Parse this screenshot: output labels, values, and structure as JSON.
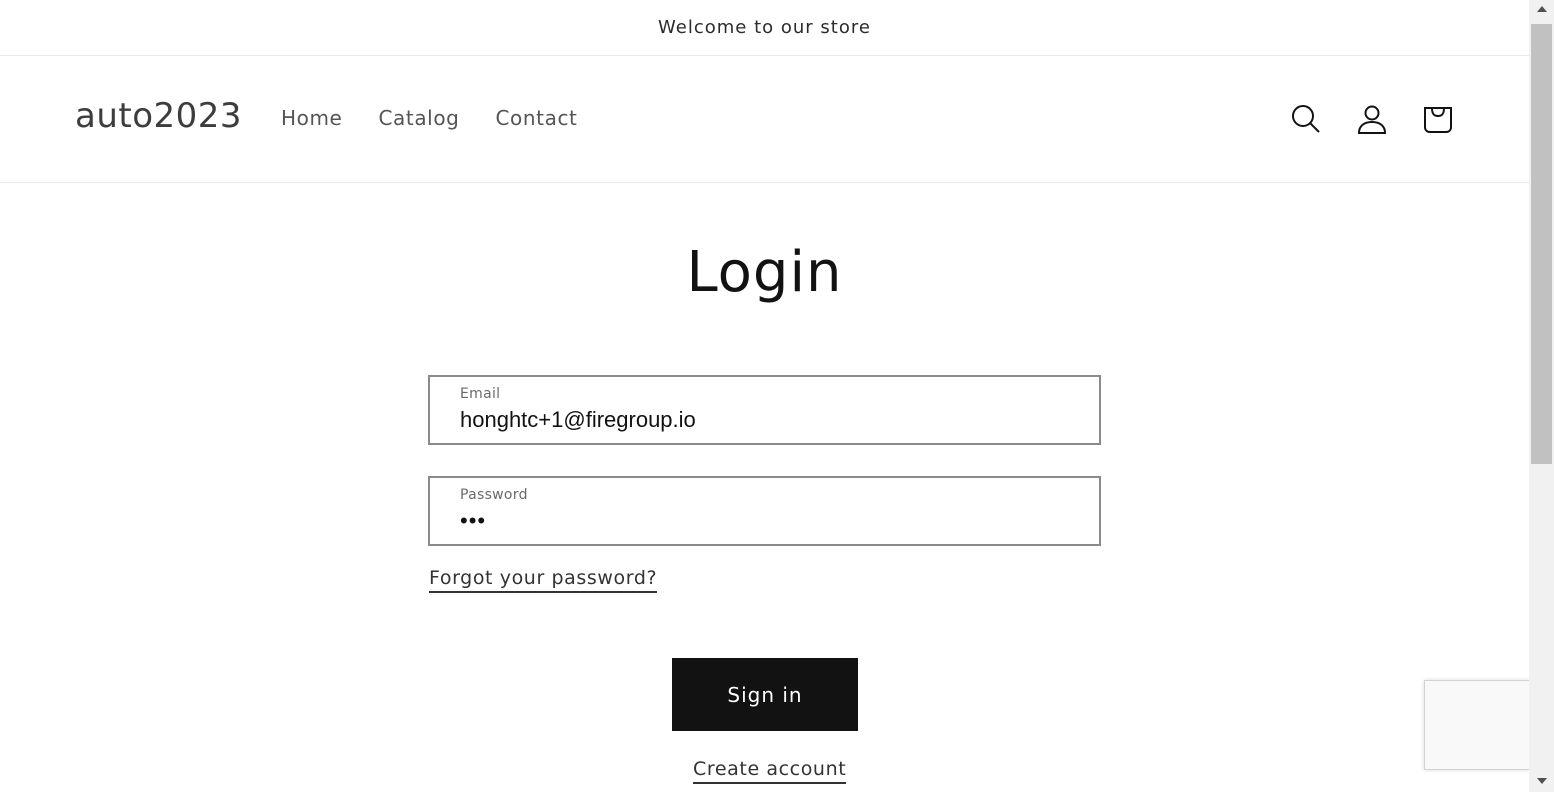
{
  "announcement": {
    "text": "Welcome to our store"
  },
  "header": {
    "logo": "auto2023",
    "nav": [
      {
        "label": "Home"
      },
      {
        "label": "Catalog"
      },
      {
        "label": "Contact"
      }
    ],
    "icons": [
      "search-icon",
      "account-icon",
      "cart-icon"
    ]
  },
  "main": {
    "title": "Login",
    "email": {
      "label": "Email",
      "value": "honghtc+1@firegroup.io"
    },
    "password": {
      "label": "Password",
      "value": "•••"
    },
    "forgot_link": "Forgot your password?",
    "sign_in_button": "Sign in",
    "create_account_link": "Create account"
  },
  "colors": {
    "button_bg": "#121212",
    "button_text": "#ffffff",
    "border": "#8a8a8a"
  }
}
